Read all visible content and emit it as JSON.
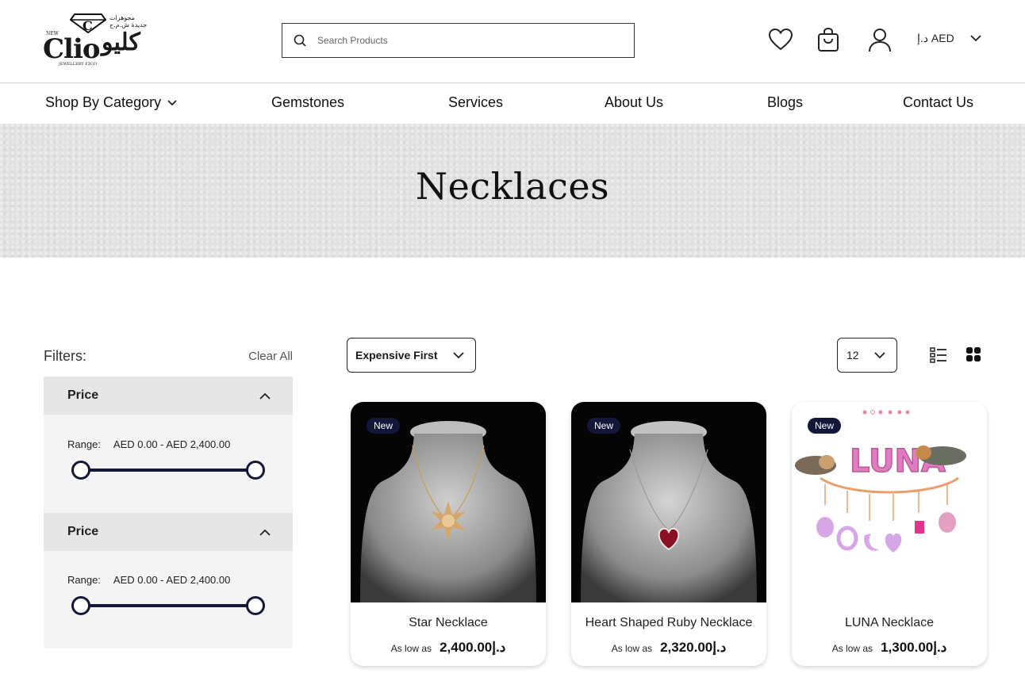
{
  "header": {
    "logo": {
      "new": "NEW",
      "latin": "Clio",
      "arabic": "كليو",
      "arabic_small": "مجوهرات جديدة ش.م.ح",
      "sub": "JEWELLERY FZCO"
    },
    "search_placeholder": "Search Products",
    "currency": "د.إ AED"
  },
  "nav": {
    "items": [
      {
        "label": "Shop By Category",
        "has_dropdown": true
      },
      {
        "label": "Gemstones"
      },
      {
        "label": "Services"
      },
      {
        "label": "About Us"
      },
      {
        "label": "Blogs"
      },
      {
        "label": "Contact Us"
      }
    ]
  },
  "banner": {
    "title": "Necklaces"
  },
  "filters": {
    "title": "Filters:",
    "clear_all": "Clear All",
    "panels": [
      {
        "label": "Price",
        "range_label": "Range:",
        "range_value": "AED 0.00 - AED 2,400.00"
      },
      {
        "label": "Price",
        "range_label": "Range:",
        "range_value": "AED 0.00 - AED 2,400.00"
      }
    ]
  },
  "toolbar": {
    "sort_value": "Expensive First",
    "per_page_value": "12"
  },
  "products": [
    {
      "badge": "New",
      "name": "Star Necklace",
      "price_prefix": "As low as",
      "price": "د.إ2,400.00"
    },
    {
      "badge": "New",
      "name": "Heart Shaped Ruby Necklace",
      "price_prefix": "As low as",
      "price": "د.إ2,320.00"
    },
    {
      "badge": "New",
      "name": "LUNA Necklace",
      "price_prefix": "As low as",
      "price": "د.إ1,300.00",
      "image_text": "LUNA"
    }
  ],
  "colors": {
    "accent": "#14163a",
    "banner": "#e2e2e2",
    "filter_bg": "#f4f4f4",
    "filter_header": "#e6e6e6"
  }
}
